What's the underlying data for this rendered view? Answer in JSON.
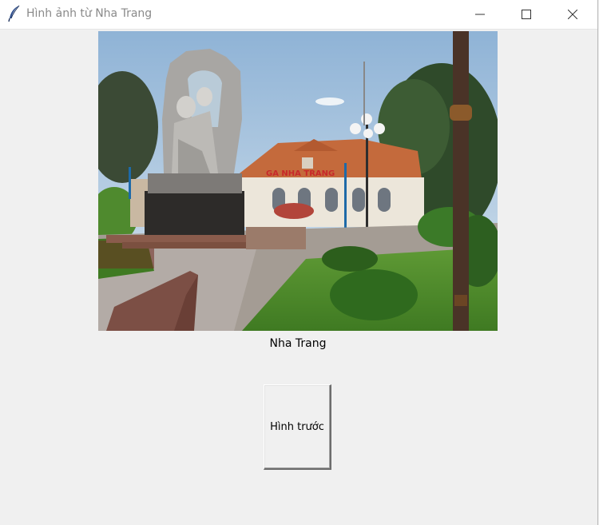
{
  "window": {
    "title": "Hình ảnh từ Nha Trang",
    "app_icon": "feather-icon",
    "controls": {
      "minimize": "minimize-icon",
      "maximize": "maximize-icon",
      "close": "close-icon"
    }
  },
  "photo": {
    "sign_text": "GA NHA TRANG"
  },
  "caption": "Nha Trang",
  "buttons": {
    "previous_label": "Hình trước"
  }
}
